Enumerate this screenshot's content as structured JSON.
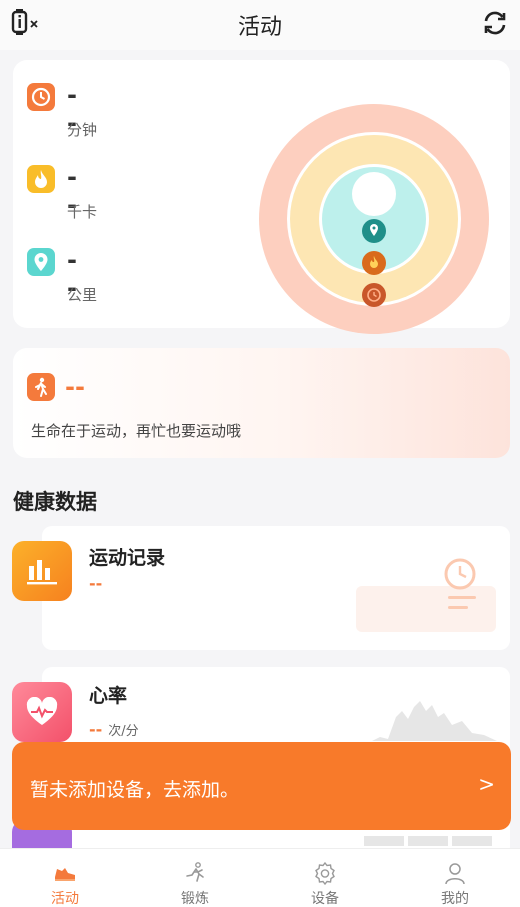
{
  "header": {
    "title": "活动"
  },
  "metrics": [
    {
      "value": "--",
      "unit": "分钟",
      "icon": "clock-icon",
      "color": "#f47a3c"
    },
    {
      "value": "--",
      "unit": "千卡",
      "icon": "flame-icon",
      "color": "#f9bd29"
    },
    {
      "value": "--",
      "unit": "公里",
      "icon": "location-icon",
      "color": "#5bd6cf"
    }
  ],
  "steps": {
    "value": "--",
    "motto": "生命在于运动，再忙也要运动哦",
    "icon": "walking-icon"
  },
  "health_section_title": "健康数据",
  "health_cards": [
    {
      "title": "运动记录",
      "value": "--",
      "unit": "",
      "icon": "bar-chart-icon"
    },
    {
      "title": "心率",
      "value": "--",
      "unit": "次/分",
      "icon": "heart-icon"
    }
  ],
  "banner": {
    "text": "暂未添加设备，去添加。",
    "chevron": ">"
  },
  "nav": [
    {
      "label": "活动",
      "icon": "running-shoe-icon",
      "active": true
    },
    {
      "label": "锻炼",
      "icon": "runner-icon",
      "active": false
    },
    {
      "label": "设备",
      "icon": "gear-icon",
      "active": false
    },
    {
      "label": "我的",
      "icon": "person-icon",
      "active": false
    }
  ],
  "colors": {
    "accent": "#f47a3c",
    "banner": "#f87a2a"
  }
}
